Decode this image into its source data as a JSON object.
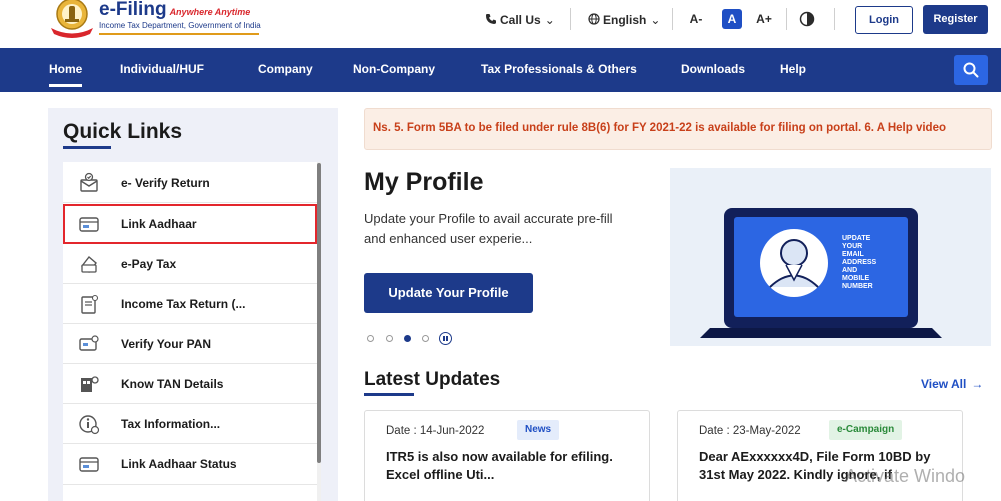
{
  "brand": {
    "name": "e-Filing",
    "tagline": "Anywhere Anytime",
    "subtitle": "Income Tax Department, Government of India"
  },
  "header": {
    "call_us": "Call Us",
    "language": "English",
    "font_decrease": "A-",
    "font_normal": "A",
    "font_increase": "A+",
    "login": "Login",
    "register": "Register"
  },
  "nav": {
    "items": [
      "Home",
      "Individual/HUF",
      "Company",
      "Non-Company",
      "Tax Professionals & Others",
      "Downloads",
      "Help"
    ]
  },
  "quick_links": {
    "title": "Quick Links",
    "items": [
      {
        "label": "e- Verify Return",
        "icon": "verify-return-icon"
      },
      {
        "label": "Link Aadhaar",
        "icon": "link-aadhaar-icon"
      },
      {
        "label": "e-Pay Tax",
        "icon": "pay-tax-icon"
      },
      {
        "label": "Income Tax Return (...",
        "icon": "itr-icon"
      },
      {
        "label": "Verify Your PAN",
        "icon": "verify-pan-icon"
      },
      {
        "label": "Know TAN Details",
        "icon": "tan-icon"
      },
      {
        "label": "Tax Information...",
        "icon": "tax-info-icon"
      },
      {
        "label": "Link Aadhaar Status",
        "icon": "aadhaar-status-icon"
      }
    ],
    "highlighted": "Link Aadhaar"
  },
  "ticker": {
    "text": "Ns. 5. Form 5BA to be filed under rule 8B(6) for FY 2021-22 is available for filing on portal. 6. A Help video"
  },
  "profile": {
    "title": "My Profile",
    "description": "Update your Profile to avail accurate pre-fill and enhanced user experie...",
    "button": "Update Your Profile",
    "carousel_active": 3,
    "carousel_count": 4
  },
  "banner": {
    "text": "UPDATE YOUR EMAIL ADDRESS AND MOBILE NUMBER"
  },
  "latest_updates": {
    "title": "Latest Updates",
    "view_all": "View All",
    "cards": [
      {
        "date": "Date : 14-Jun-2022",
        "badge": "News",
        "text": "ITR5 is also now available for efiling. Excel offline Uti..."
      },
      {
        "date": "Date : 23-May-2022",
        "badge": "e-Campaign",
        "text": "Dear AExxxxxx4D, File Form 10BD by 31st May 2022. Kindly ignore, if"
      }
    ]
  },
  "watermark": {
    "text": "Activate Windo"
  },
  "colors": {
    "primary": "#1d3a8a",
    "accent": "#2c66e3",
    "highlight": "#e3262c",
    "ticker": "#c8401a"
  }
}
